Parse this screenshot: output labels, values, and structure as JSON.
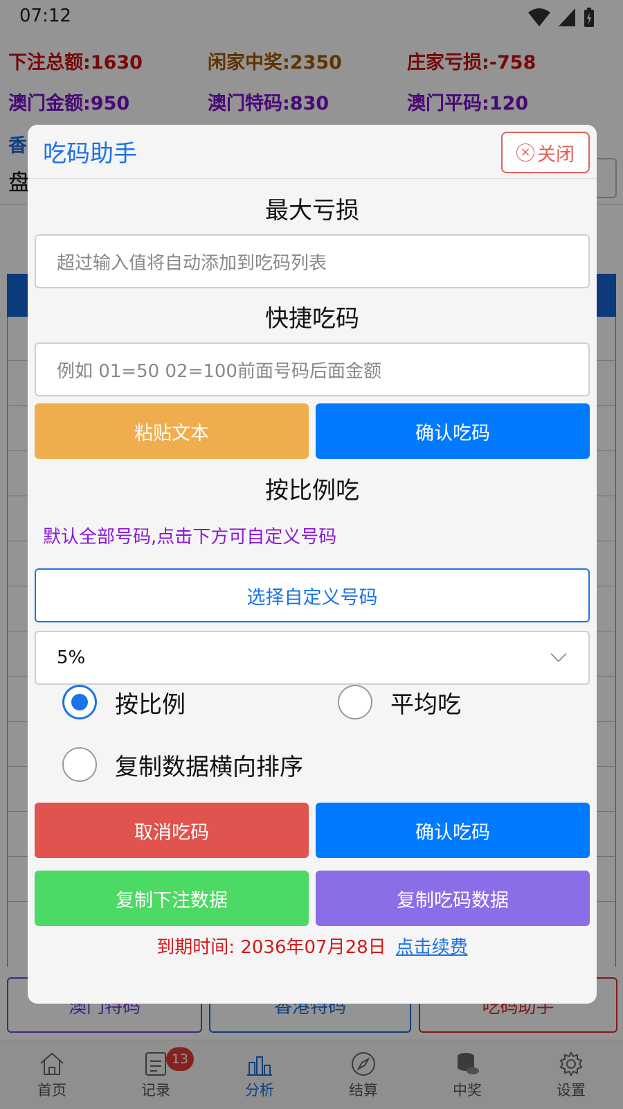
{
  "status_bar": {
    "time": "07:12"
  },
  "stats": {
    "row1": [
      "下注总额:1630",
      "闲家中奖:2350",
      "庄家亏损:-758"
    ],
    "row2": [
      "澳门金额:950",
      "澳门特码:830",
      "澳门平码:120"
    ],
    "row3_partial": "香",
    "row4_partial": "盘"
  },
  "background_buttons": [
    "澳门特码",
    "香港特码",
    "吃码助手"
  ],
  "tabbar": {
    "tabs": [
      {
        "label": "首页",
        "icon": "home-icon"
      },
      {
        "label": "记录",
        "icon": "clipboard-icon",
        "badge": "13"
      },
      {
        "label": "分析",
        "icon": "chart-icon",
        "active": true
      },
      {
        "label": "结算",
        "icon": "compass-icon"
      },
      {
        "label": "中奖",
        "icon": "coins-icon"
      },
      {
        "label": "设置",
        "icon": "gear-icon"
      }
    ]
  },
  "dialog": {
    "title": "吃码助手",
    "close_label": "关闭",
    "max_loss_title": "最大亏损",
    "max_loss_placeholder": "超过输入值将自动添加到吃码列表",
    "quick_title": "快捷吃码",
    "quick_placeholder": "例如 01=50  02=100前面号码后面金额",
    "paste_button": "粘贴文本",
    "confirm_button_1": "确认吃码",
    "ratio_title": "按比例吃",
    "ratio_hint": "默认全部号码,点击下方可自定义号码",
    "custom_numbers_button": "选择自定义号码",
    "percent_selected": "5%",
    "radio_ratio": "按比例",
    "radio_average": "平均吃",
    "radio_horizontal": "复制数据横向排序",
    "cancel_button": "取消吃码",
    "confirm_button_2": "确认吃码",
    "copy_bet_button": "复制下注数据",
    "copy_eat_button": "复制吃码数据",
    "expiry_label": "到期时间: 2036年07月28日",
    "renew_link": "点击续费"
  },
  "colors": {
    "accent_blue": "#007aff",
    "paste_orange": "#f0ad4e",
    "cancel_red": "#e0534e",
    "copy_green": "#4cd964",
    "copy_purple": "#8b6de8"
  }
}
